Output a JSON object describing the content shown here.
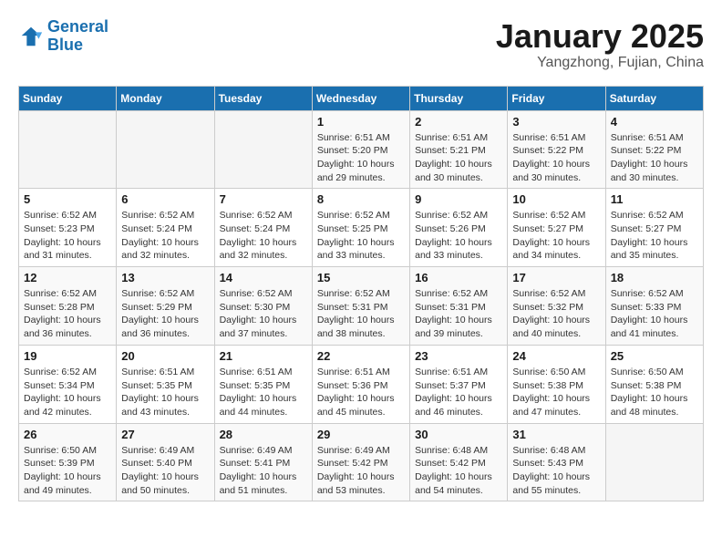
{
  "header": {
    "logo_line1": "General",
    "logo_line2": "Blue",
    "month_year": "January 2025",
    "location": "Yangzhong, Fujian, China"
  },
  "weekdays": [
    "Sunday",
    "Monday",
    "Tuesday",
    "Wednesday",
    "Thursday",
    "Friday",
    "Saturday"
  ],
  "weeks": [
    [
      {
        "day": "",
        "info": ""
      },
      {
        "day": "",
        "info": ""
      },
      {
        "day": "",
        "info": ""
      },
      {
        "day": "1",
        "info": "Sunrise: 6:51 AM\nSunset: 5:20 PM\nDaylight: 10 hours\nand 29 minutes."
      },
      {
        "day": "2",
        "info": "Sunrise: 6:51 AM\nSunset: 5:21 PM\nDaylight: 10 hours\nand 30 minutes."
      },
      {
        "day": "3",
        "info": "Sunrise: 6:51 AM\nSunset: 5:22 PM\nDaylight: 10 hours\nand 30 minutes."
      },
      {
        "day": "4",
        "info": "Sunrise: 6:51 AM\nSunset: 5:22 PM\nDaylight: 10 hours\nand 30 minutes."
      }
    ],
    [
      {
        "day": "5",
        "info": "Sunrise: 6:52 AM\nSunset: 5:23 PM\nDaylight: 10 hours\nand 31 minutes."
      },
      {
        "day": "6",
        "info": "Sunrise: 6:52 AM\nSunset: 5:24 PM\nDaylight: 10 hours\nand 32 minutes."
      },
      {
        "day": "7",
        "info": "Sunrise: 6:52 AM\nSunset: 5:24 PM\nDaylight: 10 hours\nand 32 minutes."
      },
      {
        "day": "8",
        "info": "Sunrise: 6:52 AM\nSunset: 5:25 PM\nDaylight: 10 hours\nand 33 minutes."
      },
      {
        "day": "9",
        "info": "Sunrise: 6:52 AM\nSunset: 5:26 PM\nDaylight: 10 hours\nand 33 minutes."
      },
      {
        "day": "10",
        "info": "Sunrise: 6:52 AM\nSunset: 5:27 PM\nDaylight: 10 hours\nand 34 minutes."
      },
      {
        "day": "11",
        "info": "Sunrise: 6:52 AM\nSunset: 5:27 PM\nDaylight: 10 hours\nand 35 minutes."
      }
    ],
    [
      {
        "day": "12",
        "info": "Sunrise: 6:52 AM\nSunset: 5:28 PM\nDaylight: 10 hours\nand 36 minutes."
      },
      {
        "day": "13",
        "info": "Sunrise: 6:52 AM\nSunset: 5:29 PM\nDaylight: 10 hours\nand 36 minutes."
      },
      {
        "day": "14",
        "info": "Sunrise: 6:52 AM\nSunset: 5:30 PM\nDaylight: 10 hours\nand 37 minutes."
      },
      {
        "day": "15",
        "info": "Sunrise: 6:52 AM\nSunset: 5:31 PM\nDaylight: 10 hours\nand 38 minutes."
      },
      {
        "day": "16",
        "info": "Sunrise: 6:52 AM\nSunset: 5:31 PM\nDaylight: 10 hours\nand 39 minutes."
      },
      {
        "day": "17",
        "info": "Sunrise: 6:52 AM\nSunset: 5:32 PM\nDaylight: 10 hours\nand 40 minutes."
      },
      {
        "day": "18",
        "info": "Sunrise: 6:52 AM\nSunset: 5:33 PM\nDaylight: 10 hours\nand 41 minutes."
      }
    ],
    [
      {
        "day": "19",
        "info": "Sunrise: 6:52 AM\nSunset: 5:34 PM\nDaylight: 10 hours\nand 42 minutes."
      },
      {
        "day": "20",
        "info": "Sunrise: 6:51 AM\nSunset: 5:35 PM\nDaylight: 10 hours\nand 43 minutes."
      },
      {
        "day": "21",
        "info": "Sunrise: 6:51 AM\nSunset: 5:35 PM\nDaylight: 10 hours\nand 44 minutes."
      },
      {
        "day": "22",
        "info": "Sunrise: 6:51 AM\nSunset: 5:36 PM\nDaylight: 10 hours\nand 45 minutes."
      },
      {
        "day": "23",
        "info": "Sunrise: 6:51 AM\nSunset: 5:37 PM\nDaylight: 10 hours\nand 46 minutes."
      },
      {
        "day": "24",
        "info": "Sunrise: 6:50 AM\nSunset: 5:38 PM\nDaylight: 10 hours\nand 47 minutes."
      },
      {
        "day": "25",
        "info": "Sunrise: 6:50 AM\nSunset: 5:38 PM\nDaylight: 10 hours\nand 48 minutes."
      }
    ],
    [
      {
        "day": "26",
        "info": "Sunrise: 6:50 AM\nSunset: 5:39 PM\nDaylight: 10 hours\nand 49 minutes."
      },
      {
        "day": "27",
        "info": "Sunrise: 6:49 AM\nSunset: 5:40 PM\nDaylight: 10 hours\nand 50 minutes."
      },
      {
        "day": "28",
        "info": "Sunrise: 6:49 AM\nSunset: 5:41 PM\nDaylight: 10 hours\nand 51 minutes."
      },
      {
        "day": "29",
        "info": "Sunrise: 6:49 AM\nSunset: 5:42 PM\nDaylight: 10 hours\nand 53 minutes."
      },
      {
        "day": "30",
        "info": "Sunrise: 6:48 AM\nSunset: 5:42 PM\nDaylight: 10 hours\nand 54 minutes."
      },
      {
        "day": "31",
        "info": "Sunrise: 6:48 AM\nSunset: 5:43 PM\nDaylight: 10 hours\nand 55 minutes."
      },
      {
        "day": "",
        "info": ""
      }
    ]
  ]
}
